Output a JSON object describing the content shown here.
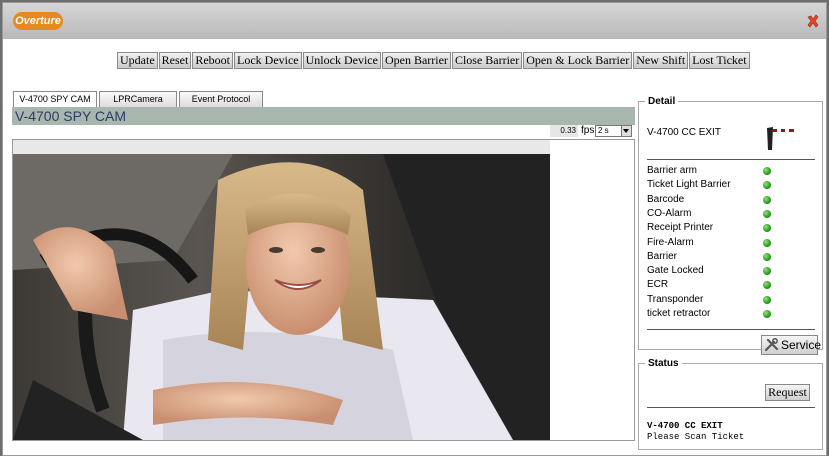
{
  "app": {
    "logo_text": "Overture"
  },
  "toolbar": {
    "buttons": [
      "Update",
      "Reset",
      "Reboot",
      "Lock Device",
      "Unlock Device",
      "Open Barrier",
      "Close Barrier",
      "Open & Lock Barrier",
      "New Shift",
      "Lost Ticket"
    ]
  },
  "tabs": [
    {
      "label": "V-4700 SPY CAM",
      "active": true
    },
    {
      "label": "LPRCamera",
      "active": false
    },
    {
      "label": "Event Protocol",
      "active": false
    }
  ],
  "camera": {
    "title": "V-4700 SPY CAM",
    "fps_value": "0.33",
    "fps_label": "fps",
    "interval_selected": "2 s"
  },
  "detail": {
    "legend": "Detail",
    "device_name": "V-4700 CC EXIT",
    "status_color": "#2ea41e",
    "items": [
      {
        "label": "Barrier arm"
      },
      {
        "label": "Ticket Light Barrier"
      },
      {
        "label": "Barcode"
      },
      {
        "label": "CO-Alarm"
      },
      {
        "label": "Receipt Printer"
      },
      {
        "label": "Fire-Alarm"
      },
      {
        "label": "Barrier"
      },
      {
        "label": "Gate Locked"
      },
      {
        "label": "ECR"
      },
      {
        "label": "Transponder"
      },
      {
        "label": "ticket retractor"
      }
    ],
    "service_label": "Service"
  },
  "status": {
    "legend": "Status",
    "request_label": "Request",
    "line1": "V-4700 CC EXIT",
    "line2": "Please Scan Ticket"
  }
}
